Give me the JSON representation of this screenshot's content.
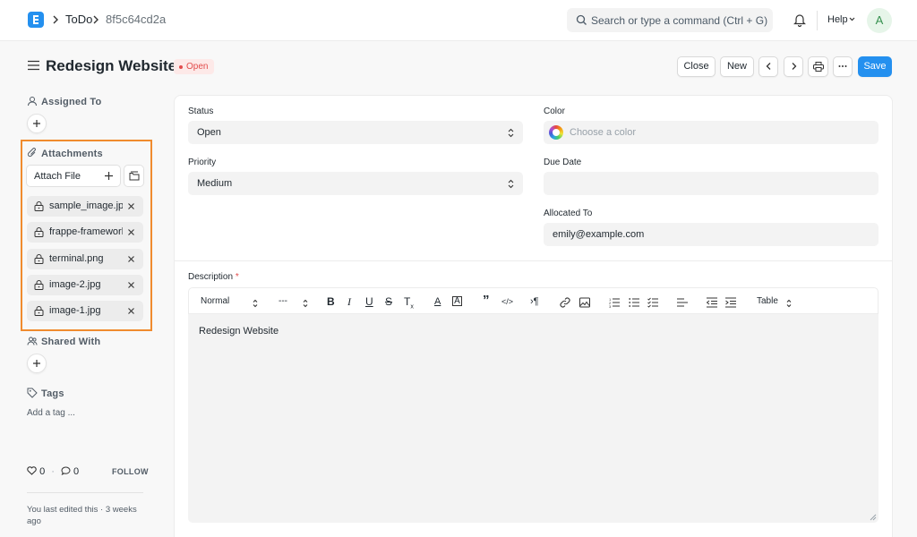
{
  "navbar": {
    "breadcrumbs": [
      "ToDo",
      "8f5c64cd2a"
    ],
    "search_placeholder": "Search or type a command (Ctrl + G)",
    "help_label": "Help",
    "avatar_initial": "A"
  },
  "page": {
    "title": "Redesign Website",
    "status": "Open",
    "status_color": "#e24c4c",
    "actions": {
      "close": "Close",
      "new": "New",
      "save": "Save"
    }
  },
  "sidebar": {
    "assigned_to_label": "Assigned To",
    "attachments_label": "Attachments",
    "attach_file_label": "Attach File",
    "attachments": [
      "sample_image.jpg",
      "frappe-framework",
      "terminal.png",
      "image-2.jpg",
      "image-1.jpg"
    ],
    "shared_with_label": "Shared With",
    "tags_label": "Tags",
    "add_tag_label": "Add a tag ...",
    "likes_count": "0",
    "comments_count": "0",
    "follow_label": "FOLLOW",
    "last_edited": "You last edited this · 3 weeks ago",
    "highlight_color": "#f08b2e"
  },
  "form": {
    "status_label": "Status",
    "status_value": "Open",
    "priority_label": "Priority",
    "priority_value": "Medium",
    "color_label": "Color",
    "color_placeholder": "Choose a color",
    "due_date_label": "Due Date",
    "due_date_value": "",
    "allocated_to_label": "Allocated To",
    "allocated_to_value": "emily@example.com",
    "description_label": "Description",
    "description_required_mark": "*",
    "description_value": "Redesign Website",
    "toolbar": {
      "heading_select": "Normal",
      "size_select": "---",
      "table_select": "Table"
    }
  },
  "accent_color": "#2490ef"
}
